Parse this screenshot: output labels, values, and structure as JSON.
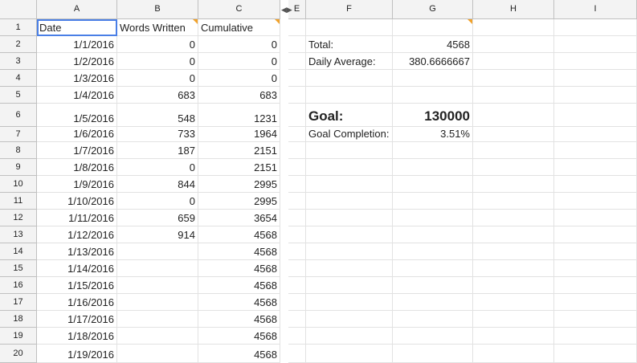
{
  "column_headers": [
    "A",
    "B",
    "C",
    "E",
    "F",
    "G",
    "H",
    "I"
  ],
  "hidden_col_arrows": {
    "left": "◀",
    "right": "▶"
  },
  "row_numbers": [
    "1",
    "2",
    "3",
    "4",
    "5",
    "6",
    "7",
    "8",
    "9",
    "10",
    "11",
    "12",
    "13",
    "14",
    "15",
    "16",
    "17",
    "18",
    "19",
    "20"
  ],
  "headers_row": {
    "date": "Date",
    "words": "Words Written",
    "cumulative": "Cumulative"
  },
  "rows": [
    {
      "date": "1/1/2016",
      "words": "0",
      "cumulative": "0"
    },
    {
      "date": "1/2/2016",
      "words": "0",
      "cumulative": "0"
    },
    {
      "date": "1/3/2016",
      "words": "0",
      "cumulative": "0"
    },
    {
      "date": "1/4/2016",
      "words": "683",
      "cumulative": "683"
    },
    {
      "date": "1/5/2016",
      "words": "548",
      "cumulative": "1231"
    },
    {
      "date": "1/6/2016",
      "words": "733",
      "cumulative": "1964"
    },
    {
      "date": "1/7/2016",
      "words": "187",
      "cumulative": "2151"
    },
    {
      "date": "1/8/2016",
      "words": "0",
      "cumulative": "2151"
    },
    {
      "date": "1/9/2016",
      "words": "844",
      "cumulative": "2995"
    },
    {
      "date": "1/10/2016",
      "words": "0",
      "cumulative": "2995"
    },
    {
      "date": "1/11/2016",
      "words": "659",
      "cumulative": "3654"
    },
    {
      "date": "1/12/2016",
      "words": "914",
      "cumulative": "4568"
    },
    {
      "date": "1/13/2016",
      "words": "",
      "cumulative": "4568"
    },
    {
      "date": "1/14/2016",
      "words": "",
      "cumulative": "4568"
    },
    {
      "date": "1/15/2016",
      "words": "",
      "cumulative": "4568"
    },
    {
      "date": "1/16/2016",
      "words": "",
      "cumulative": "4568"
    },
    {
      "date": "1/17/2016",
      "words": "",
      "cumulative": "4568"
    },
    {
      "date": "1/18/2016",
      "words": "",
      "cumulative": "4568"
    },
    {
      "date": "1/19/2016",
      "words": "",
      "cumulative": "4568"
    }
  ],
  "summary": {
    "total_label": "Total:",
    "total_value": "4568",
    "avg_label": "Daily Average:",
    "avg_value": "380.6666667",
    "goal_label": "Goal:",
    "goal_value": "130000",
    "completion_label": "Goal Completion:",
    "completion_value": "3.51%"
  },
  "colors": {
    "selection": "#4a7fe6",
    "note_marker": "#f1a22b",
    "header_bg": "#f3f3f3"
  }
}
